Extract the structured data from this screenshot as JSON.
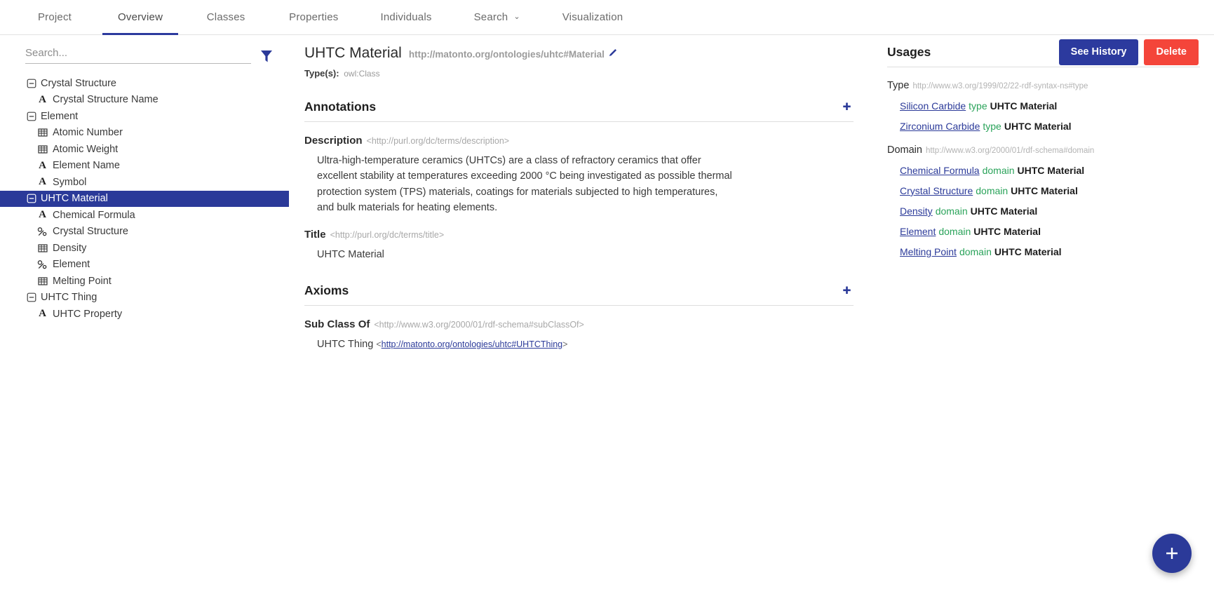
{
  "nav": {
    "tabs": [
      {
        "label": "Project",
        "active": false,
        "caret": false
      },
      {
        "label": "Overview",
        "active": true,
        "caret": false
      },
      {
        "label": "Classes",
        "active": false,
        "caret": false
      },
      {
        "label": "Properties",
        "active": false,
        "caret": false
      },
      {
        "label": "Individuals",
        "active": false,
        "caret": false
      },
      {
        "label": "Search",
        "active": false,
        "caret": true
      },
      {
        "label": "Visualization",
        "active": false,
        "caret": false
      }
    ],
    "caret_glyph": "⌄"
  },
  "sidebar": {
    "search": {
      "value": "",
      "placeholder": "Search..."
    },
    "filter_icon": "filter-funnel-icon",
    "tree": [
      {
        "label": "Crystal Structure",
        "level": 0,
        "icon": "collapse-toggle-icon",
        "selected": false
      },
      {
        "label": "Crystal Structure Name",
        "level": 1,
        "icon": "datatype-property-icon",
        "selected": false
      },
      {
        "label": "Element",
        "level": 0,
        "icon": "collapse-toggle-icon",
        "selected": false
      },
      {
        "label": "Atomic Number",
        "level": 1,
        "icon": "numeric-property-icon",
        "selected": false
      },
      {
        "label": "Atomic Weight",
        "level": 1,
        "icon": "numeric-property-icon",
        "selected": false
      },
      {
        "label": "Element Name",
        "level": 1,
        "icon": "datatype-property-icon",
        "selected": false
      },
      {
        "label": "Symbol",
        "level": 1,
        "icon": "datatype-property-icon",
        "selected": false
      },
      {
        "label": "UHTC Material",
        "level": 0,
        "icon": "collapse-toggle-icon",
        "selected": true
      },
      {
        "label": "Chemical Formula",
        "level": 1,
        "icon": "datatype-property-icon",
        "selected": false
      },
      {
        "label": "Crystal Structure",
        "level": 1,
        "icon": "object-property-icon",
        "selected": false
      },
      {
        "label": "Density",
        "level": 1,
        "icon": "numeric-property-icon",
        "selected": false
      },
      {
        "label": "Element",
        "level": 1,
        "icon": "object-property-icon",
        "selected": false
      },
      {
        "label": "Melting Point",
        "level": 1,
        "icon": "numeric-property-icon",
        "selected": false
      },
      {
        "label": "UHTC Thing",
        "level": 0,
        "icon": "collapse-toggle-icon",
        "selected": false
      },
      {
        "label": "UHTC Property",
        "level": 1,
        "icon": "datatype-property-icon",
        "selected": false
      }
    ]
  },
  "entity": {
    "title": "UHTC Material",
    "iri": "http://matonto.org/ontologies/uhtc#Material",
    "edit_icon": "pencil-edit-icon",
    "types_label": "Type(s):",
    "types_value": "owl:Class"
  },
  "actions": {
    "see_history": "See History",
    "delete": "Delete",
    "add_fab": "add-plus-fab"
  },
  "annotations": {
    "heading": "Annotations",
    "add_icon": "plus-icon",
    "items": [
      {
        "name": "Description",
        "iri": "<http://purl.org/dc/terms/description>",
        "value": "Ultra-high-temperature ceramics (UHTCs) are a class of refractory ceramics that offer excellent stability at temperatures exceeding 2000 °C being investigated as possible thermal protection system (TPS) materials, coatings for materials subjected to high temperatures, and bulk materials for heating elements."
      },
      {
        "name": "Title",
        "iri": "<http://purl.org/dc/terms/title>",
        "value": "UHTC Material"
      }
    ]
  },
  "axioms": {
    "heading": "Axioms",
    "add_icon": "plus-icon",
    "items": [
      {
        "name": "Sub Class Of",
        "iri": "<http://www.w3.org/2000/01/rdf-schema#subClassOf>",
        "value_label": "UHTC Thing",
        "value_link": "http://matonto.org/ontologies/uhtc#UHTCThing",
        "open_angle": "<",
        "close_angle": ">"
      }
    ]
  },
  "usages": {
    "heading": "Usages",
    "groups": [
      {
        "predicate": "Type",
        "predicate_iri": "http://www.w3.org/1999/02/22-rdf-syntax-ns#type",
        "rows": [
          {
            "subject": "Silicon Carbide",
            "predicate": "type",
            "object": "UHTC Material"
          },
          {
            "subject": "Zirconium Carbide",
            "predicate": "type",
            "object": "UHTC Material"
          }
        ]
      },
      {
        "predicate": "Domain",
        "predicate_iri": "http://www.w3.org/2000/01/rdf-schema#domain",
        "rows": [
          {
            "subject": "Chemical Formula",
            "predicate": "domain",
            "object": "UHTC Material"
          },
          {
            "subject": "Crystal Structure",
            "predicate": "domain",
            "object": "UHTC Material"
          },
          {
            "subject": "Density",
            "predicate": "domain",
            "object": "UHTC Material"
          },
          {
            "subject": "Element",
            "predicate": "domain",
            "object": "UHTC Material"
          },
          {
            "subject": "Melting Point",
            "predicate": "domain",
            "object": "UHTC Material"
          }
        ]
      }
    ]
  },
  "colors": {
    "primary": "#2b3a99",
    "danger": "#f4453a",
    "predicate_green": "#2aa35a",
    "link_blue": "#2b3a99",
    "selected_row": "#2b3a99"
  }
}
